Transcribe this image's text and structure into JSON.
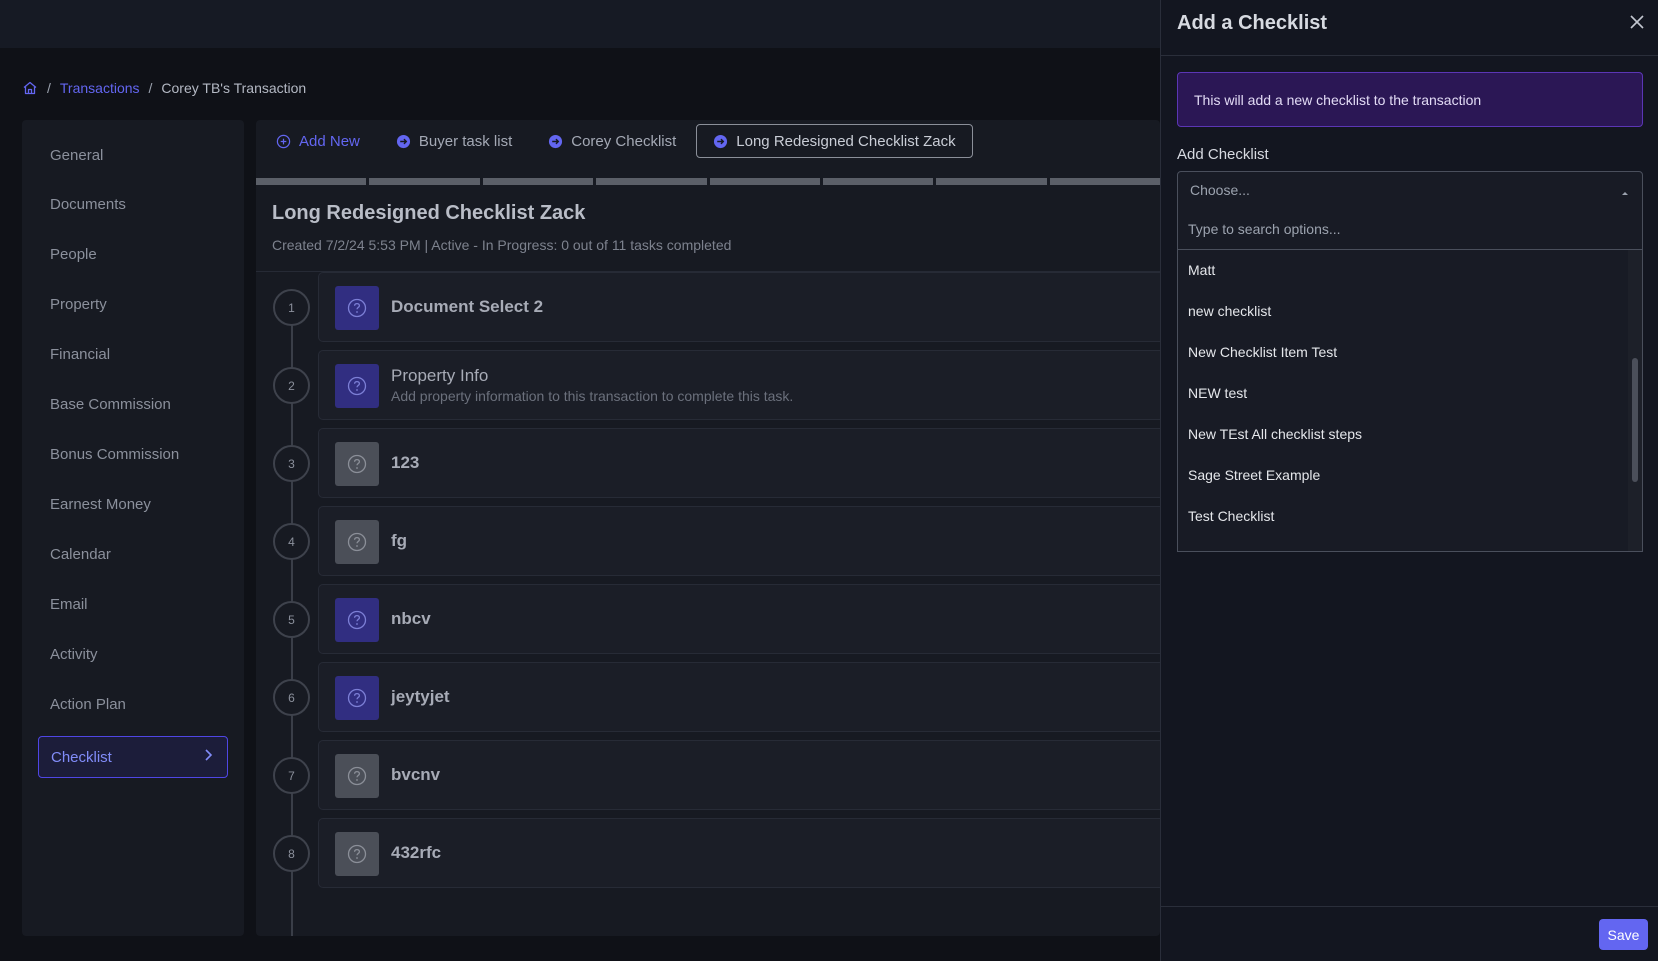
{
  "breadcrumb": {
    "home_icon": "home-icon",
    "separator": "/",
    "items": [
      "Transactions",
      "Corey TB's Transaction"
    ]
  },
  "sidebar": {
    "items": [
      "General",
      "Documents",
      "People",
      "Property",
      "Financial",
      "Base Commission",
      "Bonus Commission",
      "Earnest Money",
      "Calendar",
      "Email",
      "Activity",
      "Action Plan"
    ],
    "active": "Checklist"
  },
  "tabs": {
    "add_new": "Add New",
    "items": [
      "Buyer task list",
      "Corey Checklist",
      "Long Redesigned Checklist Zack"
    ]
  },
  "checklist": {
    "title": "Long Redesigned Checklist Zack",
    "meta": "Created 7/2/24 5:53 PM  |  Active - In Progress: 0 out of 11 tasks completed",
    "tasks": [
      {
        "num": "1",
        "name": "Document Select 2",
        "desc": "",
        "color": "blue"
      },
      {
        "num": "2",
        "name": "Property Info",
        "desc": "Add property information to this transaction to complete this task.",
        "color": "blue"
      },
      {
        "num": "3",
        "name": "123",
        "desc": "",
        "color": "gray"
      },
      {
        "num": "4",
        "name": "fg",
        "desc": "",
        "color": "gray"
      },
      {
        "num": "5",
        "name": "nbcv",
        "desc": "",
        "color": "blue"
      },
      {
        "num": "6",
        "name": "jeytyjet",
        "desc": "",
        "color": "blue"
      },
      {
        "num": "7",
        "name": "bvcnv",
        "desc": "",
        "color": "gray"
      },
      {
        "num": "8",
        "name": "432rfc",
        "desc": "",
        "color": "gray"
      }
    ]
  },
  "drawer": {
    "title": "Add a Checklist",
    "info": "This will add a new checklist to the transaction",
    "field_label": "Add Checklist",
    "select_placeholder": "Choose...",
    "search_placeholder": "Type to search options...",
    "options": [
      "Matt",
      "new checklist",
      "New Checklist Item Test",
      "NEW test",
      "New TEst All checklist steps",
      "Sage Street Example",
      "Test Checklist"
    ],
    "save_label": "Save"
  },
  "colors": {
    "accent": "#6366f1",
    "info_bg": "#2b1755",
    "info_border": "#5b36b5",
    "badge_blue": "#312e81",
    "badge_gray": "#4b4f58"
  }
}
